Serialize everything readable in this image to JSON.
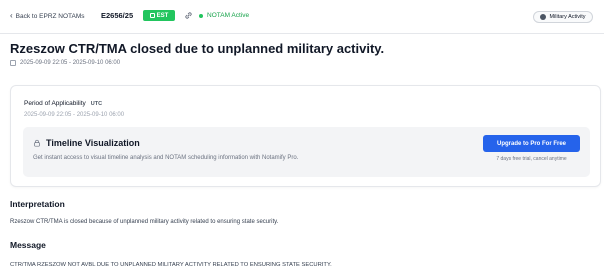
{
  "header": {
    "back_label": "Back to EPRZ NOTAMs",
    "notam_id": "E2656/25",
    "est_badge": "EST",
    "status": "NOTAM Active",
    "category_tag": "Military Activity"
  },
  "notam": {
    "title": "Rzeszow CTR/TMA closed due to unplanned military activity.",
    "date_range": "2025-09-09 22:05 - 2025-09-10 06:00"
  },
  "applicability": {
    "label": "Period of Applicability",
    "timezone": "UTC",
    "range": "2025-09-09 22:05 - 2025-09-10 06:00"
  },
  "timeline": {
    "title": "Timeline Visualization",
    "description": "Get instant access to visual timeline analysis and NOTAM scheduling information with Notamify Pro.",
    "cta_label": "Upgrade to Pro For Free",
    "trial_note": "7 days free trial, cancel anytime"
  },
  "interpretation": {
    "heading": "Interpretation",
    "text": "Rzeszow CTR/TMA is closed because of unplanned military activity related to ensuring state security."
  },
  "message": {
    "heading": "Message",
    "text": "CTR/TMA RZESZOW NOT AVBL DUE TO UNPLANNED MILITARY ACTIVITY RELATED TO ENSURING STATE SECURITY."
  },
  "icons": {
    "back": "chevron-left-icon",
    "calendar": "calendar-icon",
    "link": "link-icon",
    "status": "status-dot-icon",
    "tag": "military-icon",
    "lock": "lock-icon"
  },
  "colors": {
    "accent": "#2563eb",
    "active": "#22c55e"
  }
}
